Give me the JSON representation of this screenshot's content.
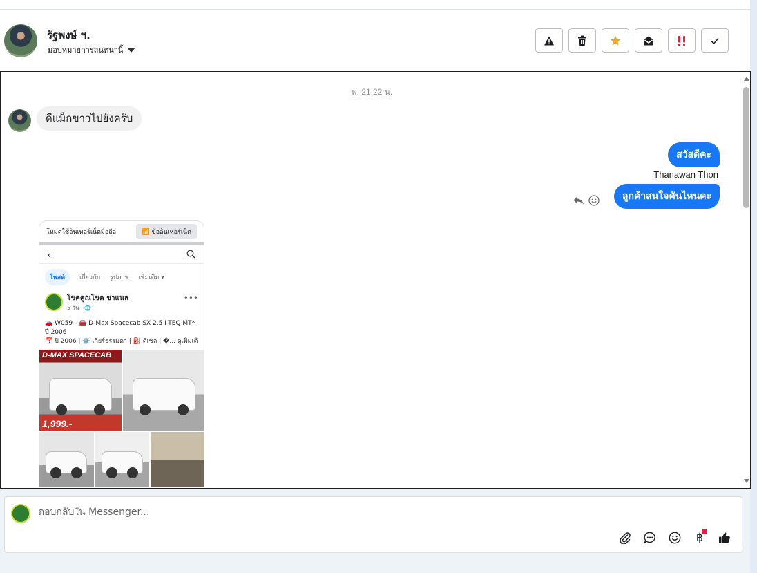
{
  "header": {
    "contact_name": "รัฐพงษ์ ฯ.",
    "assign_label": "มอบหมายการสนทนานี้"
  },
  "actions": [
    {
      "name": "report-spam-button",
      "icon": "warning-triangle-icon"
    },
    {
      "name": "delete-button",
      "icon": "trash-icon"
    },
    {
      "name": "star-button",
      "icon": "star-icon",
      "color": "#f5a623"
    },
    {
      "name": "mark-unread-button",
      "icon": "envelope-open-icon"
    },
    {
      "name": "mark-urgent-button",
      "icon": "double-exclamation-icon",
      "color": "#e41e3f"
    },
    {
      "name": "mark-done-button",
      "icon": "check-icon"
    }
  ],
  "chat": {
    "timestamp": "พ. 21:22 น.",
    "incoming_text": "ดีแม็กขาวไปยังครับ",
    "outgoing": [
      {
        "text": "สวัสดีคะ"
      },
      {
        "text": "ลูกค้าสนใจคันไหนคะ"
      }
    ],
    "sender_name": "Thanawan Thon",
    "accent_color": "#1877f2"
  },
  "shared_screenshot": {
    "top_left_text": "โหมดใช้อินเทอร์เน็ตมือถือ",
    "top_right_text": "📶 ข้ออินเทอร์เน็ต",
    "tabs": [
      "โพสต์",
      "เกี่ยวกับ",
      "รูปภาพ",
      "เพิ่มเติม ▾"
    ],
    "page_name": "โชคคูณโชค ชาแนล",
    "post_time": "5 วัน · 🌐",
    "post_line1": "🚗 W059 - 🚘 D-Max Spacecab SX 2.5 I-TEQ MT* ปี 2006",
    "post_line2": "📅 ปี 2006 | ⚙️ เกียร์ธรรมดา | ⛽ ดีเซล | �... ดูเพิ่มเติม",
    "photo_brand": "D-MAX SPACECAB",
    "photo_price": "1,999.-"
  },
  "composer": {
    "placeholder": "ตอบกลับใน Messenger..."
  }
}
